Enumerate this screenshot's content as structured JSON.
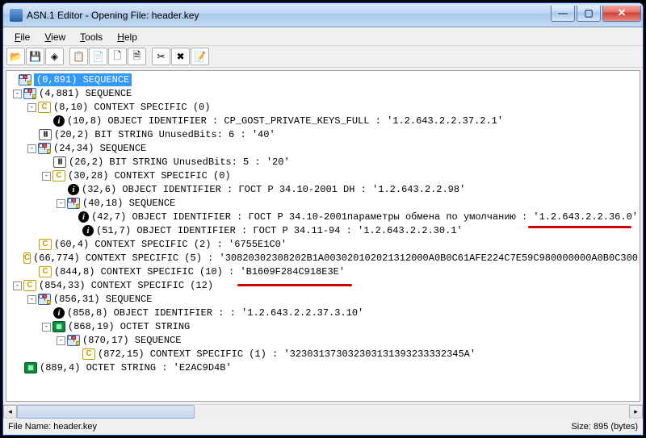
{
  "title": "ASN.1 Editor - Opening File: header.key",
  "menus": {
    "file": "File",
    "view": "View",
    "tools": "Tools",
    "help": "Help"
  },
  "status": {
    "left": "File Name: header.key",
    "right": "Size: 895 (bytes)"
  },
  "tree": {
    "n0": "(0,891) SEQUENCE",
    "n1": "(4,881) SEQUENCE",
    "n2": "(8,10) CONTEXT SPECIFIC (0)",
    "n3": "(10,8) OBJECT IDENTIFIER : CP_GOST_PRIVATE_KEYS_FULL : '1.2.643.2.2.37.2.1'",
    "n4": "(20,2) BIT STRING UnusedBits: 6 : '40'",
    "n5": "(24,34) SEQUENCE",
    "n6": "(26,2) BIT STRING UnusedBits: 5 : '20'",
    "n7": "(30,28) CONTEXT SPECIFIC (0)",
    "n8": "(32,6) OBJECT IDENTIFIER : ГОСТ Р 34.10-2001 DH : '1.2.643.2.2.98'",
    "n9": "(40,18) SEQUENCE",
    "n10": "(42,7) OBJECT IDENTIFIER : ГОСТ Р 34.10-2001параметры обмена по умолчанию : '1.2.643.2.2.36.0'",
    "n11": "(51,7) OBJECT IDENTIFIER : ГОСТ Р 34.11-94 : '1.2.643.2.2.30.1'",
    "n12": "(60,4) CONTEXT SPECIFIC (2) : '6755E1C0'",
    "n13": "(66,774) CONTEXT SPECIFIC (5) : '30820302308202B1A003020102021312000A0B0C61AFE224C7E59C980000000A0B0C300",
    "n14": "(844,8) CONTEXT SPECIFIC (10) : 'B1609F284C918E3E'",
    "n15": "(854,33) CONTEXT SPECIFIC (12)",
    "n16": "(856,31) SEQUENCE",
    "n17": "(858,8) OBJECT IDENTIFIER :  : '1.2.643.2.2.37.3.10'",
    "n18": "(868,19) OCTET STRING",
    "n19": "(870,17) SEQUENCE",
    "n20": "(872,15) CONTEXT SPECIFIC (1) : '323031373032303131393233332345A'",
    "n21": "(889,4) OCTET STRING : 'E2AC9D4B'"
  }
}
